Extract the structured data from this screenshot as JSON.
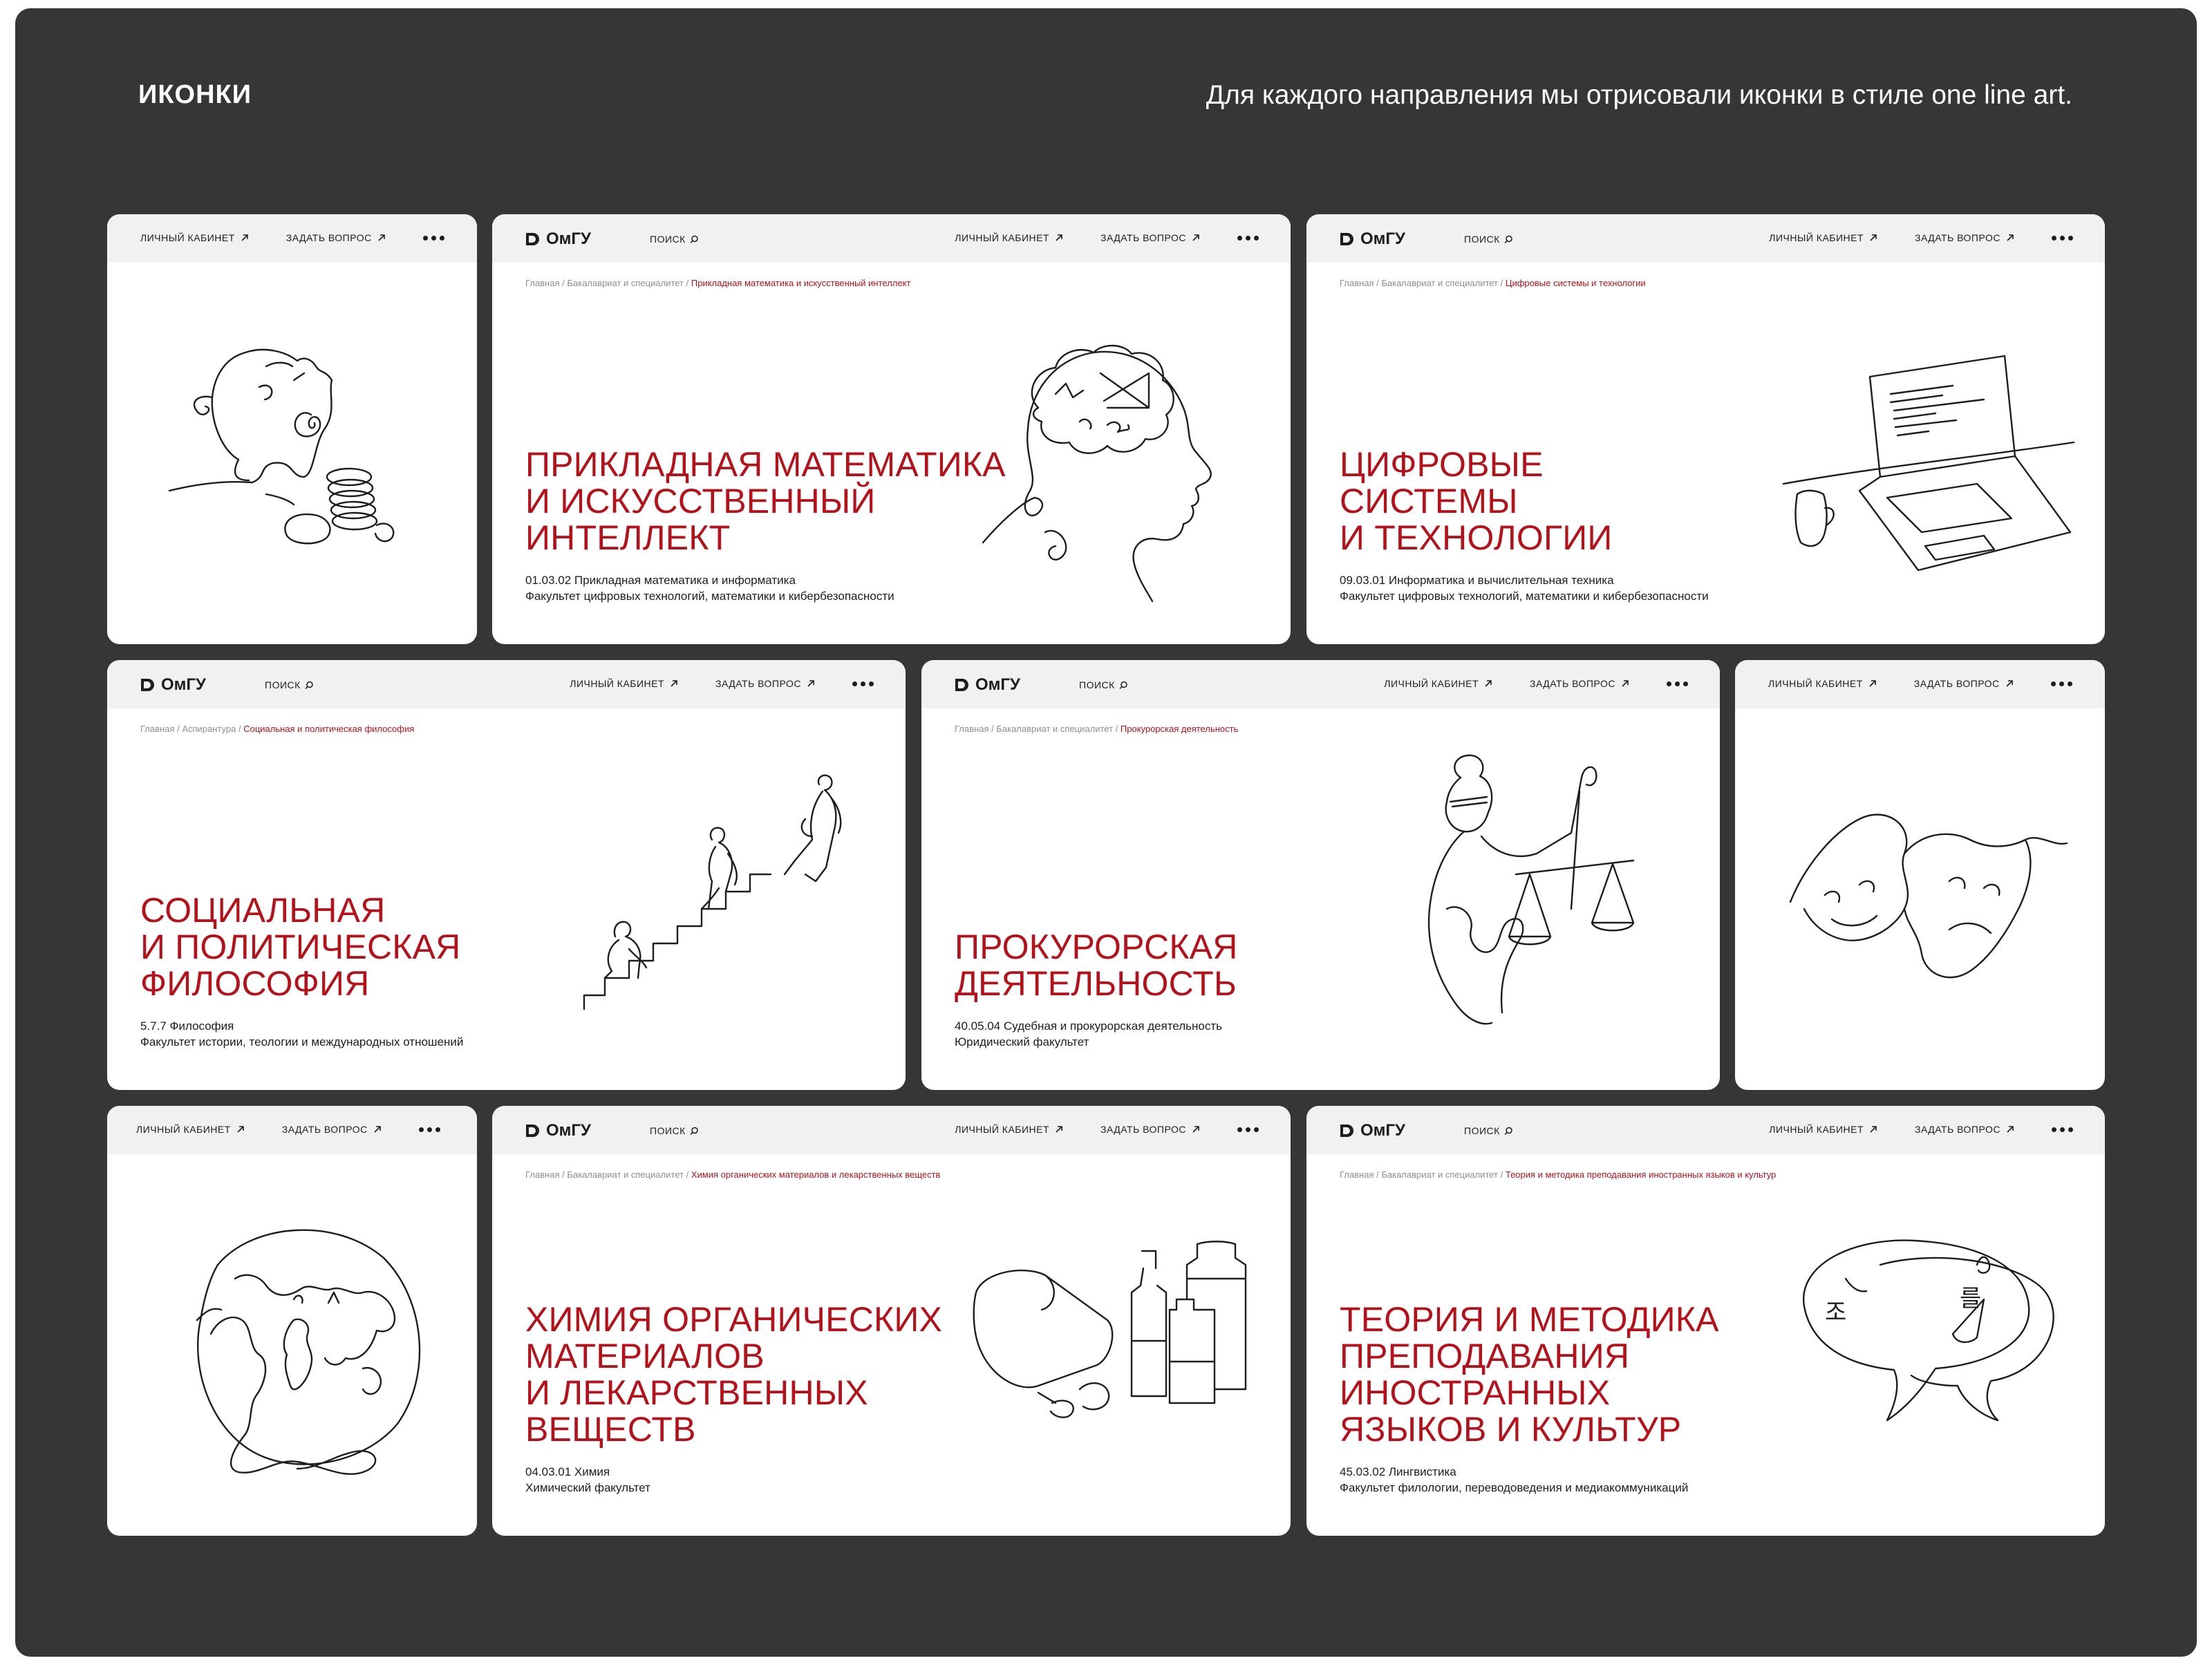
{
  "header": {
    "title": "ИКОНКИ",
    "subtitle": "Для каждого направления мы отрисовали иконки в стиле one line art."
  },
  "nav": {
    "logo": "ОмГУ",
    "search": "ПОИСК",
    "account": "ЛИЧНЫЙ КАБИНЕТ",
    "question": "ЗАДАТЬ ВОПРОС",
    "more_icon": "more-dots-icon",
    "arrow_icon": "arrow-up-right-icon",
    "search_icon": "search-icon"
  },
  "colors": {
    "accent": "#b3121b",
    "board": "#363636",
    "nav": "#f2f1f1",
    "text": "#1d1d1d"
  },
  "cards": {
    "math": {
      "crumb1": "Главная",
      "crumb2": "Бакалавриат и специалитет",
      "crumb_current": "Прикладная математика и искусственный интеллект",
      "title_l1": "ПРИКЛАДНАЯ МАТЕМАТИКА",
      "title_l2": "И ИСКУССТВЕННЫЙ",
      "title_l3": "ИНТЕЛЛЕКТ",
      "program": "01.03.02 Прикладная математика и информатика",
      "faculty": "Факультет цифровых технологий, математики и кибербезопасности",
      "icon": "head-brain-formulas-icon"
    },
    "digital": {
      "crumb1": "Главная",
      "crumb2": "Бакалавриат и специалитет",
      "crumb_current": "Цифровые системы и технологии",
      "title_l1": "ЦИФРОВЫЕ",
      "title_l2": "СИСТЕМЫ",
      "title_l3": "И ТЕХНОЛОГИИ",
      "program": "09.03.01 Информатика и вычислительная техника",
      "faculty": "Факультет цифровых технологий, математики и кибербезопасности",
      "icon": "laptop-mug-icon"
    },
    "philosophy": {
      "crumb1": "Главная",
      "crumb2": "Аспирантура",
      "crumb_current": "Социальная и политическая философия",
      "title_l1": "СОЦИАЛЬНАЯ",
      "title_l2": "И ПОЛИТИЧЕСКАЯ",
      "title_l3": "ФИЛОСОФИЯ",
      "program": "5.7.7 Философия",
      "faculty": "Факультет истории, теологии и международных отношений",
      "icon": "evolution-stairs-icon"
    },
    "law": {
      "crumb1": "Главная",
      "crumb2": "Бакалавриат и специалитет",
      "crumb_current": "Прокурорская деятельность",
      "title_l1": "ПРОКУРОРСКАЯ",
      "title_l2": "ДЕЯТЕЛЬНОСТЬ",
      "program": "40.05.04 Судебная и прокурорская деятельность",
      "faculty": "Юридический факультет",
      "icon": "themis-scales-icon"
    },
    "chemistry": {
      "crumb1": "Главная",
      "crumb2": "Бакалавриат и специалитет",
      "crumb_current": "Химия органических материалов и лекарственных веществ",
      "title_l1": "ХИМИЯ ОРГАНИЧЕСКИХ",
      "title_l2": "МАТЕРИАЛОВ",
      "title_l3": "И ЛЕКАРСТВЕННЫХ",
      "title_l4": "ВЕЩЕСТВ",
      "program": "04.03.01 Химия",
      "faculty": "Химический факультет",
      "icon": "medicine-bottles-icon"
    },
    "languages": {
      "crumb1": "Главная",
      "crumb2": "Бакалавриат и специалитет",
      "crumb_current": "Теория и методика преподавания иностранных языков и культур",
      "title_l1": "ТЕОРИЯ И МЕТОДИКА",
      "title_l2": "ПРЕПОДАВАНИЯ",
      "title_l3": "ИНОСТРАННЫХ",
      "title_l4": "ЯЗЫКОВ И КУЛЬТУР",
      "program": "45.03.02 Лингвистика",
      "faculty": "Факультет филологии, переводоведения и медиакоммуникаций",
      "icon": "speech-bubbles-icon",
      "glyph_left": "조",
      "glyph_right": "를"
    },
    "small": {
      "economics_icon": "piggy-bank-coins-icon",
      "theatre_icon": "theatre-masks-icon",
      "globe_icon": "world-globe-icon"
    }
  }
}
